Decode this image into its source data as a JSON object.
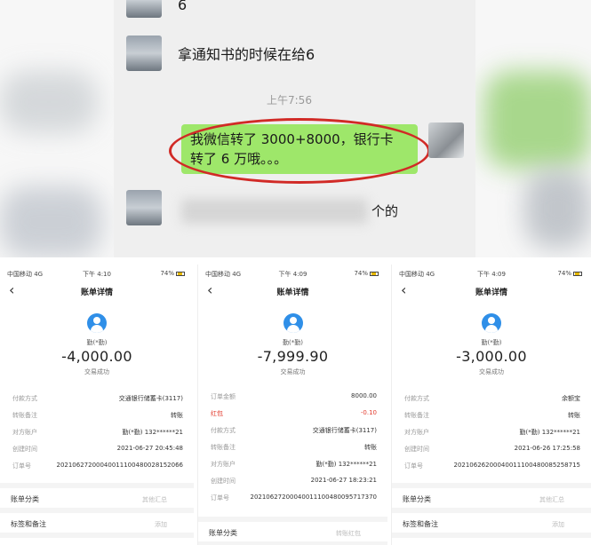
{
  "chat": {
    "top_message": "6",
    "message_1": "拿通知书的时候在给6",
    "timestamp": "上午7:56",
    "my_message_line1": "我微信转了 3000+8000，银行卡",
    "my_message_line2": "转了 6 万哦。。。",
    "message_2_tail": "个的"
  },
  "receipts": [
    {
      "status_left": "中国移动 4G",
      "status_time": "下午 4:10",
      "status_right": "74%",
      "title": "账单详情",
      "name": "勤(*勤)",
      "amount": "-4,000.00",
      "status": "交易成功",
      "rows": [
        {
          "k": "付款方式",
          "v": "交通银行储蓄卡(3117)"
        },
        {
          "k": "转账备注",
          "v": "转账"
        },
        {
          "k": "对方账户",
          "v": "勤(*勤) 132******21"
        },
        {
          "k": "创建时间",
          "v": "2021-06-27 20:45:48"
        },
        {
          "k": "订单号",
          "v": "20210627200040011100480028152066"
        }
      ],
      "sections": [
        {
          "k": "账单分类",
          "v": "其他汇总"
        },
        {
          "k": "标签和备注",
          "v": "添加"
        }
      ]
    },
    {
      "status_left": "中国移动 4G",
      "status_time": "下午 4:09",
      "status_right": "74%",
      "title": "账单详情",
      "name": "勤(*勤)",
      "amount": "-7,999.90",
      "status": "交易成功",
      "rows": [
        {
          "k": "订单金额",
          "v": "8000.00"
        },
        {
          "k": "红包",
          "v": "-0.10"
        },
        {
          "k": "付款方式",
          "v": "交通银行储蓄卡(3117)"
        },
        {
          "k": "转账备注",
          "v": "转账"
        },
        {
          "k": "对方账户",
          "v": "勤(*勤) 132******21"
        },
        {
          "k": "创建时间",
          "v": "2021-06-27 18:23:21"
        },
        {
          "k": "订单号",
          "v": "20210627200040011100480095717370"
        }
      ],
      "sections": [
        {
          "k": "账单分类",
          "v": "转账红包"
        }
      ]
    },
    {
      "status_left": "中国移动 4G",
      "status_time": "下午 4:09",
      "status_right": "74%",
      "title": "账单详情",
      "name": "勤(*勤)",
      "amount": "-3,000.00",
      "status": "交易成功",
      "rows": [
        {
          "k": "付款方式",
          "v": "余额宝"
        },
        {
          "k": "转账备注",
          "v": "转账"
        },
        {
          "k": "对方账户",
          "v": "勤(*勤) 132******21"
        },
        {
          "k": "创建时间",
          "v": "2021-06-26 17:25:58"
        },
        {
          "k": "订单号",
          "v": "20210626200040011100480085258715"
        }
      ],
      "sections": [
        {
          "k": "账单分类",
          "v": "其他汇总"
        },
        {
          "k": "标签和备注",
          "v": "添加"
        }
      ]
    }
  ],
  "colors": {
    "bubble_green": "#9ee76a",
    "highlight_red": "#d12a26",
    "accent_blue": "#2f8fe8",
    "negative_red": "#e23b2e"
  },
  "icons": {
    "back": "chevron-left-icon",
    "user": "user-avatar-icon",
    "battery": "battery-icon"
  }
}
